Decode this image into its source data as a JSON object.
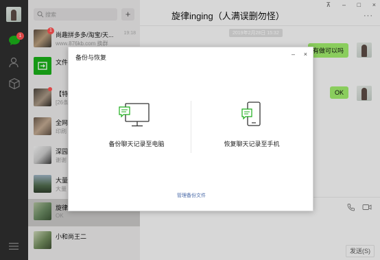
{
  "nav": {
    "chat_badge": "1"
  },
  "search": {
    "placeholder": "搜索",
    "add_label": "+"
  },
  "conversations": [
    {
      "name": "尚趣拼多多/淘宝/天...",
      "message": "www.876kb.com 换群",
      "time": "19:18",
      "badge": "1",
      "thumb_color": "#7a6a5a"
    },
    {
      "name": "文件",
      "message": "",
      "time": "",
      "thumb_color": "#1aad19"
    },
    {
      "name": "【特",
      "message": "[26条",
      "time": "",
      "thumb_color": "#8c7f72"
    },
    {
      "name": "全网",
      "message": "印刷",
      "time": "",
      "thumb_color": "#9a8b7d"
    },
    {
      "name": "深园",
      "message": "谢谢",
      "time": "",
      "thumb_color": "#d8d8d8"
    },
    {
      "name": "大量",
      "message": "大量",
      "time": "",
      "thumb_color": "#4f6a4c"
    },
    {
      "name": "旋律",
      "message": "OK",
      "time": "",
      "thumb_color": "#6b8a63"
    },
    {
      "name": "小和尚王二",
      "message": "",
      "time": "",
      "thumb_color": "#708a5c"
    }
  ],
  "chat": {
    "title": "旋律inging（人满误删勿怪）",
    "more": "···",
    "timestamp": "2019年2月28日 15:32",
    "bubble1": "有做可以吗",
    "bubble2": "OK",
    "send_label": "发送(S)"
  },
  "window": {
    "pin": "⊼",
    "min": "–",
    "max": "□",
    "close": "×"
  },
  "dialog": {
    "title": "备份与恢复",
    "min": "–",
    "close": "×",
    "backup_label": "备份聊天记录至电脑",
    "restore_label": "恢复聊天记录至手机",
    "manage_link": "管理备份文件"
  },
  "colors": {
    "nav_bg": "#2e2e2e",
    "list_bg": "#e9e8e8",
    "chat_bg": "#f5f5f5",
    "bubble_green": "#9eea6a",
    "accent_green": "#1aad19",
    "badge_red": "#fa5151",
    "link_blue": "#4a6aa8"
  }
}
